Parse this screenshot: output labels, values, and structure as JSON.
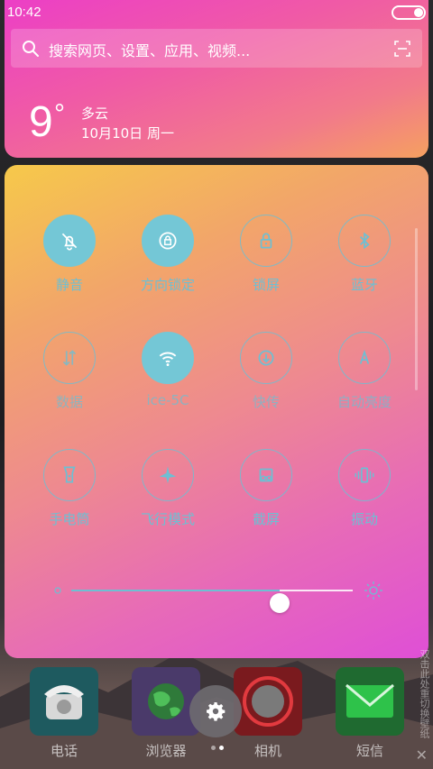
{
  "status_bar": {
    "time": "10:42"
  },
  "search": {
    "placeholder": "搜索网页、设置、应用、视频..."
  },
  "weather": {
    "temperature": "9",
    "degree": "°",
    "condition": "多云",
    "date": "10月10日 周一"
  },
  "quick_settings": {
    "tiles": [
      {
        "label": "静音",
        "icon": "bell-off-icon",
        "active": true
      },
      {
        "label": "方向锁定",
        "icon": "rotation-lock-icon",
        "active": true
      },
      {
        "label": "锁屏",
        "icon": "lock-icon",
        "active": false
      },
      {
        "label": "蓝牙",
        "icon": "bluetooth-icon",
        "active": false
      },
      {
        "label": "数据",
        "icon": "mobile-data-icon",
        "active": false
      },
      {
        "label": "ice-5C",
        "icon": "wifi-icon",
        "active": true
      },
      {
        "label": "快传",
        "icon": "fast-transfer-icon",
        "active": false
      },
      {
        "label": "自动亮度",
        "icon": "auto-brightness-icon",
        "active": false
      },
      {
        "label": "手电筒",
        "icon": "flashlight-icon",
        "active": false
      },
      {
        "label": "飞行模式",
        "icon": "airplane-icon",
        "active": false
      },
      {
        "label": "截屏",
        "icon": "screenshot-icon",
        "active": false
      },
      {
        "label": "振动",
        "icon": "vibrate-icon",
        "active": false
      }
    ],
    "brightness_level": 0.74
  },
  "dock": {
    "apps": [
      {
        "label": "电话",
        "icon": "phone-icon"
      },
      {
        "label": "浏览器",
        "icon": "browser-globe-icon"
      },
      {
        "label": "相机",
        "icon": "camera-icon"
      },
      {
        "label": "短信",
        "icon": "message-icon"
      }
    ]
  },
  "side_hint": "双击此处重切换壁纸",
  "colors": {
    "accent": "#6dbfd3",
    "active_circle": "#74c7d6"
  }
}
